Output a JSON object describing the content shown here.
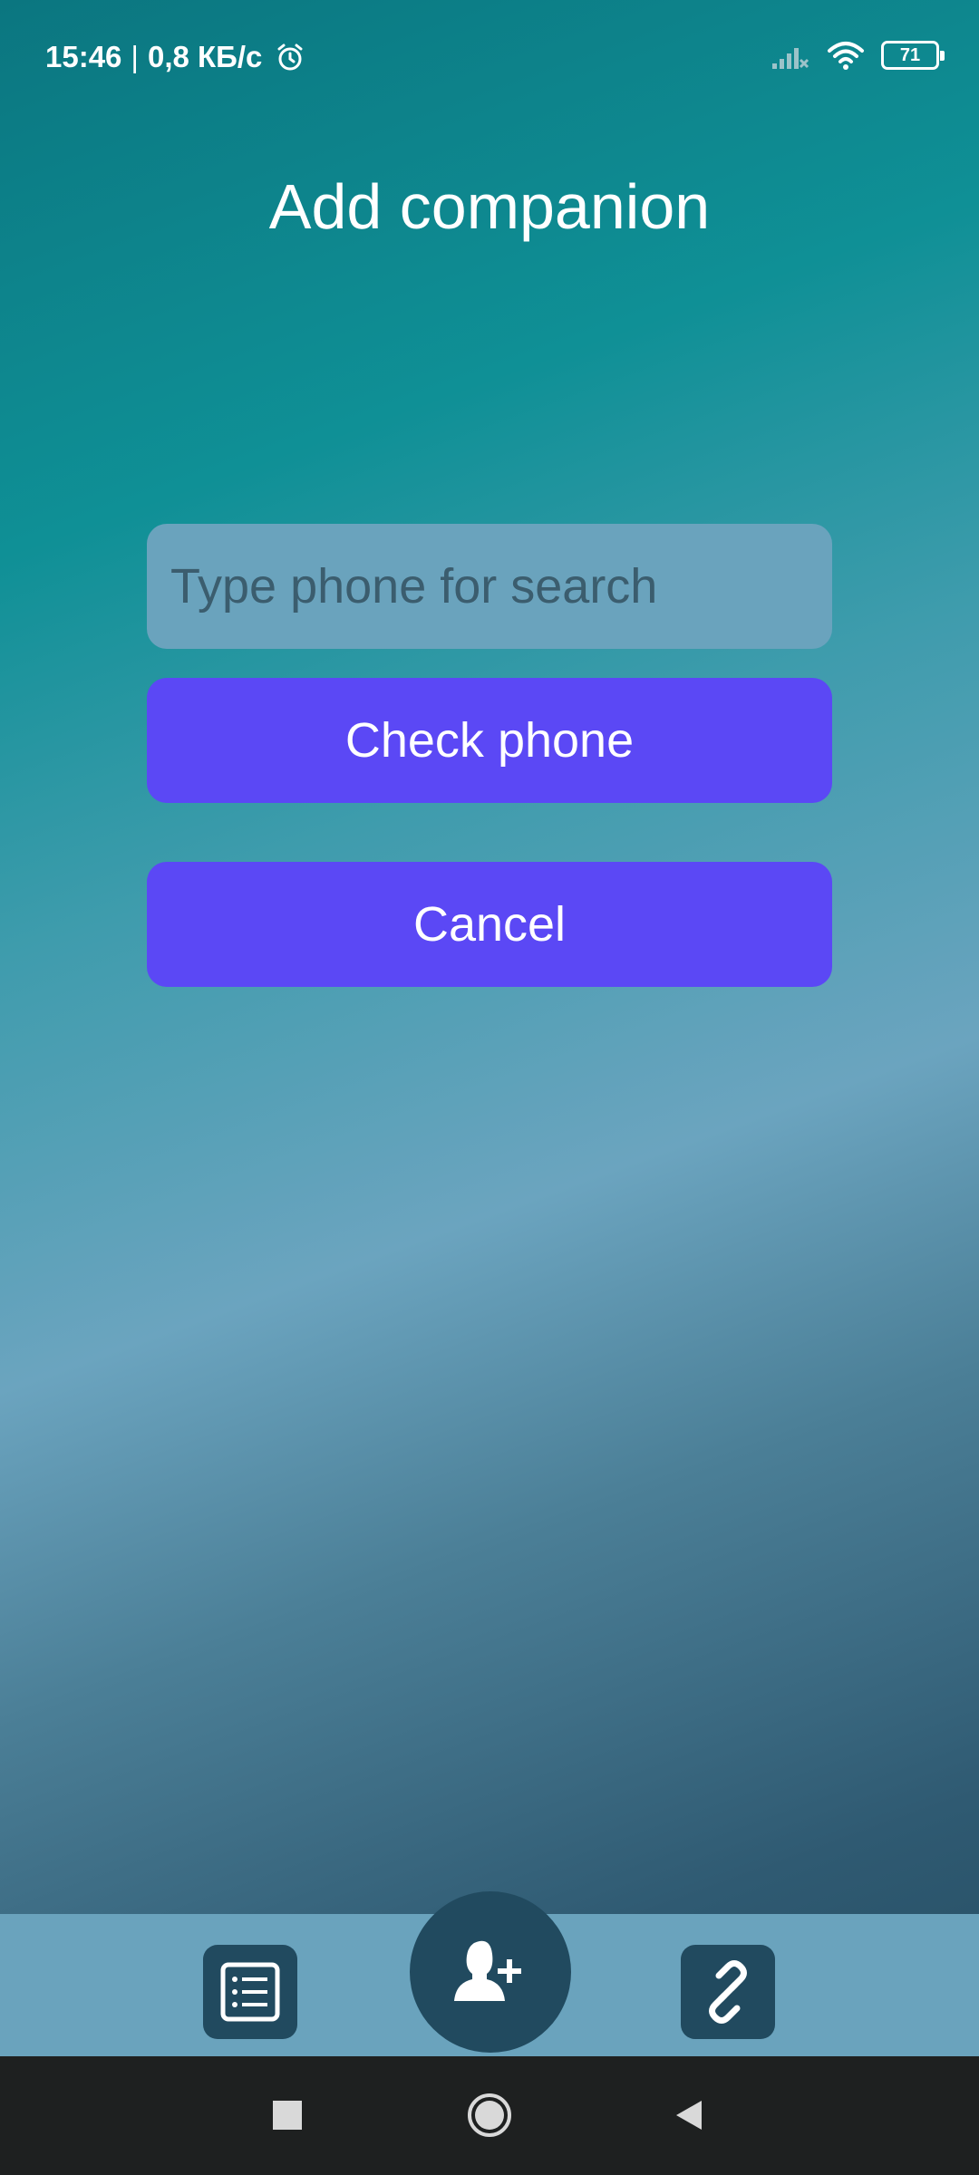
{
  "status_bar": {
    "time": "15:46",
    "separator": "|",
    "network_speed": "0,8 КБ/с",
    "battery_level": "71",
    "icons": [
      "alarm-icon",
      "signal-icon",
      "wifi-icon",
      "battery-icon"
    ]
  },
  "page": {
    "title": "Add companion"
  },
  "form": {
    "phone_placeholder": "Type phone for search",
    "phone_value": "",
    "check_label": "Check phone",
    "cancel_label": "Cancel"
  },
  "bottom_nav": {
    "items": [
      {
        "icon": "list-icon"
      },
      {
        "icon": "add-user-icon"
      },
      {
        "icon": "link-icon"
      }
    ]
  },
  "system_nav": {
    "items": [
      {
        "icon": "recent-apps-icon"
      },
      {
        "icon": "home-icon"
      },
      {
        "icon": "back-icon"
      }
    ]
  },
  "colors": {
    "accent_button": "#5b48f5",
    "input_background": "#6aa3bd",
    "nav_background": "#6aa3bd",
    "nav_button": "#214a5f",
    "system_nav": "#1e2020"
  }
}
